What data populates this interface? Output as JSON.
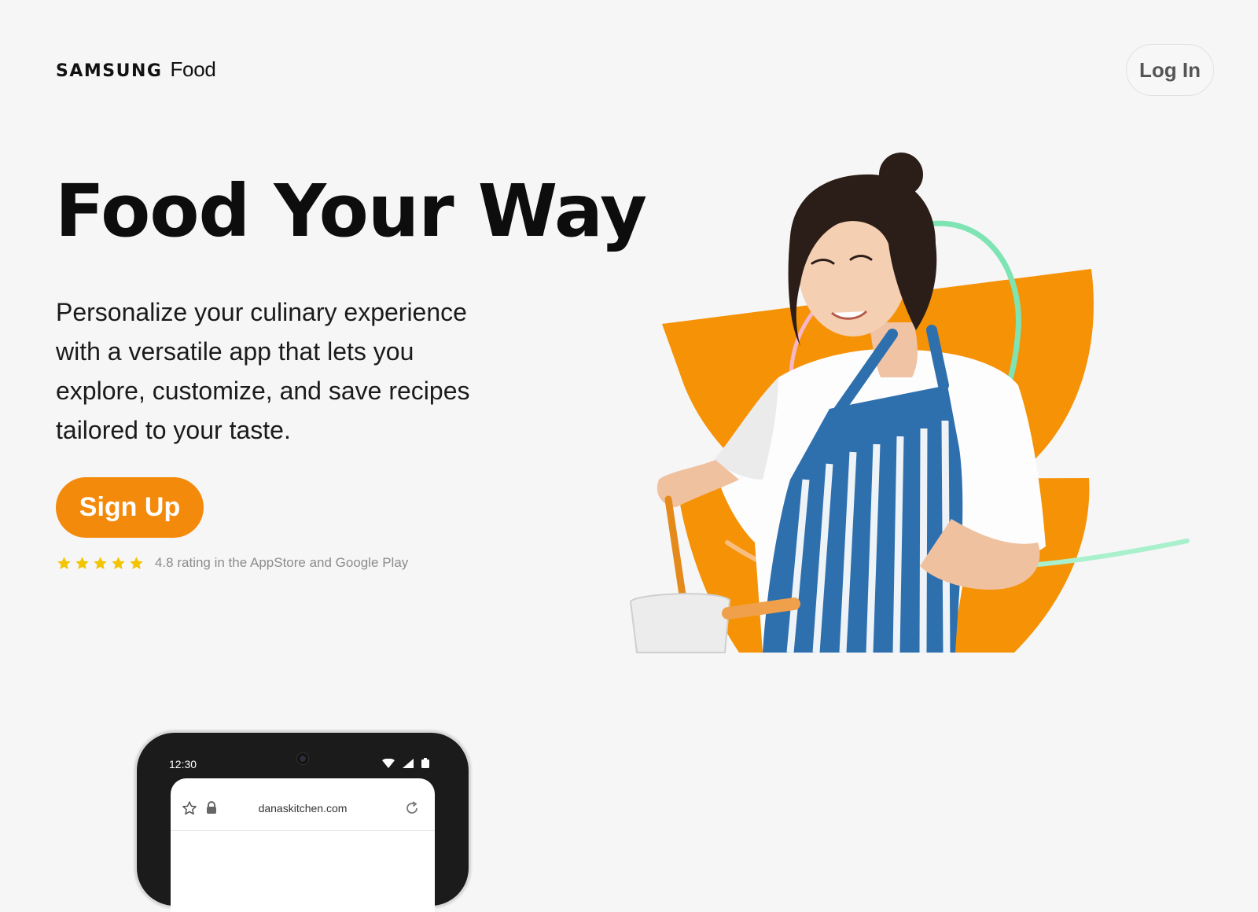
{
  "header": {
    "brand": "SAMSUNG",
    "product": "Food",
    "login_label": "Log In"
  },
  "hero": {
    "title": "Food Your Way",
    "description": "Personalize your culinary experience with a versatile app that lets you explore, customize, and save recipes tailored to your taste.",
    "signup_label": "Sign Up",
    "rating_stars": 5,
    "rating_text": "4.8 rating in the AppStore and Google Play"
  },
  "phone": {
    "time": "12:30",
    "url": "danaskitchen.com"
  },
  "icons": {
    "star": "star-icon",
    "wifi": "wifi-icon",
    "signal": "signal-icon",
    "battery": "battery-icon",
    "bookmark": "star-outline-icon",
    "lock": "lock-icon",
    "reload": "reload-icon"
  },
  "colors": {
    "background": "#f6f6f6",
    "accent": "#f48a0c",
    "star": "#f3c400",
    "mint_stroke": "#7fe4b4",
    "apron_blue": "#2e6fae"
  }
}
